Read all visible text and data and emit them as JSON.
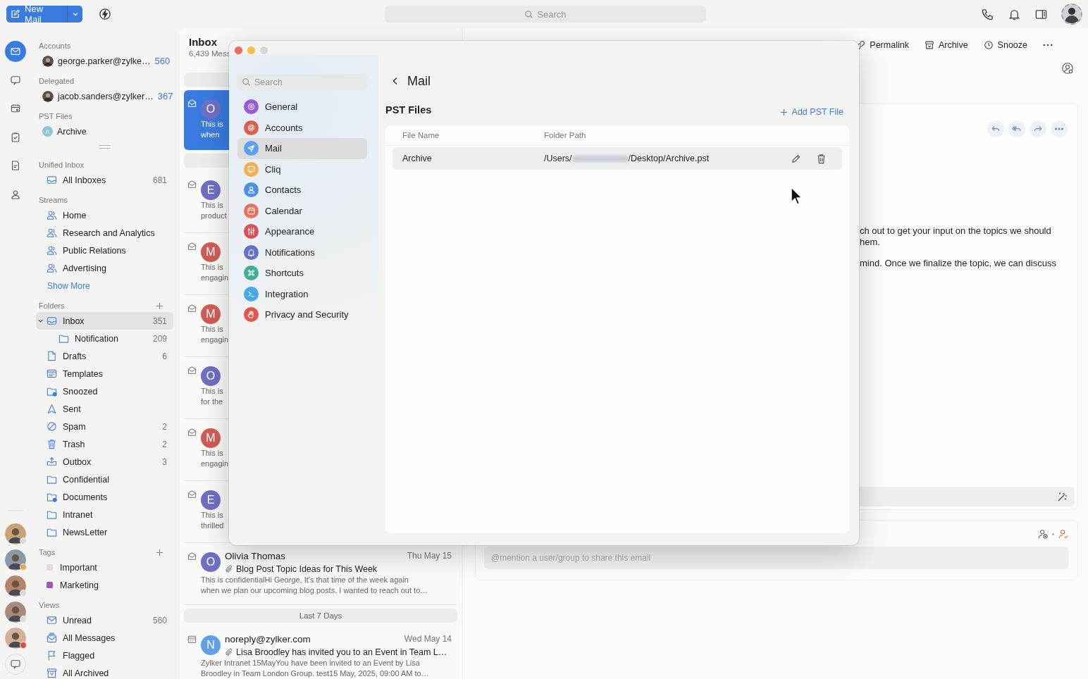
{
  "toolbar": {
    "new_mail": "New Mail",
    "search": {
      "placeholder": "Search"
    }
  },
  "rail": {
    "apps": [
      {
        "kind": "mail",
        "selected": true
      },
      {
        "kind": "chat",
        "selected": false
      },
      {
        "kind": "calendar",
        "selected": false
      },
      {
        "kind": "tasks",
        "selected": false
      },
      {
        "kind": "notes",
        "selected": false
      },
      {
        "kind": "contacts",
        "selected": false
      }
    ],
    "people": [
      {
        "color": "#d9d9d9"
      },
      {
        "color": "#f0a04b"
      },
      {
        "color": "#d9d9d9"
      },
      {
        "color": "#d9d9d9"
      },
      {
        "color": "#e8453c"
      }
    ]
  },
  "sidebar": {
    "sections": [
      {
        "title": "Accounts",
        "add": false,
        "items": [
          {
            "kind": "account",
            "label": "george.parker@zylke…",
            "count": "560",
            "selected": false
          }
        ]
      },
      {
        "title": "Delegated",
        "add": false,
        "items": [
          {
            "kind": "account",
            "label": "jacob.sanders@zylker…",
            "count": "367",
            "selected": false
          }
        ]
      },
      {
        "title": "PST Files",
        "add": false,
        "handle": true,
        "items": [
          {
            "kind": "pst",
            "badge": "A",
            "label": "Archive",
            "selected": false
          }
        ]
      },
      {
        "title": "Unified Inbox",
        "add": false,
        "items": [
          {
            "kind": "all-inboxes",
            "label": "All Inboxes",
            "count": "681",
            "selected": false
          }
        ]
      },
      {
        "title": "Streams",
        "add": false,
        "more": "Show More",
        "items": [
          {
            "kind": "stream",
            "label": "Home",
            "selected": false
          },
          {
            "kind": "stream",
            "label": "Research and Analytics",
            "selected": false
          },
          {
            "kind": "stream",
            "label": "Public Relations",
            "selected": false
          },
          {
            "kind": "stream",
            "label": "Advertising",
            "selected": false
          }
        ]
      },
      {
        "title": "Folders",
        "add": true,
        "items": [
          {
            "kind": "inbox",
            "label": "Inbox",
            "count": "351",
            "selected": true,
            "expanded": true,
            "children": [
              {
                "kind": "folder",
                "label": "Notification",
                "count": "209",
                "selected": false
              }
            ]
          },
          {
            "kind": "drafts",
            "label": "Drafts",
            "count": "6",
            "selected": false
          },
          {
            "kind": "templates",
            "label": "Templates",
            "selected": false
          },
          {
            "kind": "snoozed",
            "label": "Snoozed",
            "selected": false
          },
          {
            "kind": "sent",
            "label": "Sent",
            "selected": false
          },
          {
            "kind": "spam",
            "label": "Spam",
            "count": "2",
            "selected": false
          },
          {
            "kind": "trash",
            "label": "Trash",
            "count": "2",
            "selected": false
          },
          {
            "kind": "outbox",
            "label": "Outbox",
            "count": "3",
            "selected": false
          },
          {
            "kind": "folder",
            "label": "Confidential",
            "selected": false
          },
          {
            "kind": "shared-folder",
            "label": "Documents",
            "selected": false
          },
          {
            "kind": "folder",
            "label": "Intranet",
            "selected": false
          },
          {
            "kind": "folder",
            "label": "NewsLetter",
            "selected": false
          }
        ]
      },
      {
        "title": "Tags",
        "add": true,
        "items": [
          {
            "kind": "tag",
            "label": "Important",
            "color": "#ead6d6",
            "selected": false
          },
          {
            "kind": "tag",
            "label": "Marketing",
            "color": "#9b59b6",
            "selected": false
          }
        ]
      },
      {
        "title": "Views",
        "add": false,
        "items": [
          {
            "kind": "unread",
            "label": "Unread",
            "count": "560",
            "selected": false
          },
          {
            "kind": "all-messages",
            "label": "All Messages",
            "selected": false
          },
          {
            "kind": "flagged",
            "label": "Flagged",
            "selected": false
          },
          {
            "kind": "archived",
            "label": "All Archived",
            "selected": false
          }
        ]
      }
    ]
  },
  "mail_list": {
    "title": "Inbox",
    "subtitle": "6,439 Mess",
    "rows": [
      {
        "kind": "group"
      },
      {
        "kind": "mail",
        "avatar": "O",
        "color": "#6f6fc4",
        "preview_lines": [
          "This is",
          "when"
        ],
        "selected": true
      },
      {
        "kind": "group"
      },
      {
        "kind": "mail",
        "avatar": "E",
        "color": "#6f6fc4",
        "preview_lines": [
          "This is",
          "product"
        ],
        "selected": false
      },
      {
        "kind": "mail",
        "avatar": "M",
        "color": "#cf5e57",
        "preview_lines": [
          "This is",
          "engagin"
        ],
        "selected": false
      },
      {
        "kind": "mail",
        "avatar": "M",
        "color": "#cf5e57",
        "preview_lines": [
          "This is",
          "engagin"
        ],
        "selected": false
      },
      {
        "kind": "mail",
        "avatar": "O",
        "color": "#6f6fc4",
        "preview_lines": [
          "This is",
          "for the"
        ],
        "selected": false
      },
      {
        "kind": "mail",
        "avatar": "M",
        "color": "#cf5e57",
        "preview_lines": [
          "This is",
          "engagin"
        ],
        "selected": false
      },
      {
        "kind": "mail",
        "avatar": "E",
        "color": "#6f6fc4",
        "preview_lines": [
          "This is",
          "thrilled"
        ],
        "selected": false
      },
      {
        "kind": "mail",
        "avatar": "O",
        "color": "#6f6fc4",
        "sender": "Olivia Thomas",
        "date": "Thu May 15",
        "attachment": true,
        "subject": "Blog Post Topic Ideas for This Week",
        "preview_lines": [
          "This is confidentialHi George, It's that time of the week again",
          "when we plan our upcoming blog posts. I wanted to reach out to…"
        ],
        "selected": false
      },
      {
        "kind": "group",
        "label": "Last 7 Days"
      },
      {
        "kind": "event",
        "avatar": "N",
        "color": "#5fa0e8",
        "sender": "noreply@zylker.com",
        "date": "Wed May 14",
        "attachment": true,
        "subject": "Lisa Broodley has invited you to an Event in Team L…",
        "preview_lines": [
          "Zylker Intranet 15MayYou have been invited to an Event by Lisa",
          "Broodley in Team London Group. test15 May, 2025, 09:00 AM to…"
        ],
        "selected": false
      }
    ]
  },
  "detail": {
    "actions": [
      {
        "kind": "permalink",
        "label": "Permalink"
      },
      {
        "kind": "archive",
        "label": "Archive"
      },
      {
        "kind": "snooze",
        "label": "Snooze"
      }
    ],
    "body_lines": [
      "ch out to get your input on the topics we should",
      "hem.",
      "mind. Once we finalize the topic, we can discuss"
    ],
    "mention": {
      "placeholder": "@mention a user/group to share this email"
    }
  },
  "settings": {
    "search": {
      "placeholder": "Search"
    },
    "categories": [
      {
        "kind": "general",
        "label": "General",
        "color": "#9a5bd6",
        "selected": false
      },
      {
        "kind": "accounts",
        "label": "Accounts",
        "color": "#d9604f",
        "selected": false
      },
      {
        "kind": "mail",
        "label": "Mail",
        "color": "#5a9ff0",
        "selected": true
      },
      {
        "kind": "cliq",
        "label": "Cliq",
        "color": "#f2b04e",
        "selected": false
      },
      {
        "kind": "contacts",
        "label": "Contacts",
        "color": "#4e8fe6",
        "selected": false
      },
      {
        "kind": "calendar",
        "label": "Calendar",
        "color": "#ea7059",
        "selected": false
      },
      {
        "kind": "appearance",
        "label": "Appearance",
        "color": "#d9505a",
        "selected": false
      },
      {
        "kind": "notifications",
        "label": "Notifications",
        "color": "#6470c8",
        "selected": false
      },
      {
        "kind": "shortcuts",
        "label": "Shortcuts",
        "color": "#3eae98",
        "selected": false
      },
      {
        "kind": "integration",
        "label": "Integration",
        "color": "#4aa8e8",
        "selected": false
      },
      {
        "kind": "privacy",
        "label": "Privacy and Security",
        "color": "#e0574d",
        "selected": false
      }
    ],
    "page": {
      "title": "Mail",
      "section": "PST Files",
      "add": "Add PST File",
      "columns": [
        "File Name",
        "Folder Path"
      ],
      "files": [
        {
          "name": "Archive",
          "path_start": "/Users/",
          "redacted": true,
          "path_end": "/Desktop/Archive.pst"
        }
      ]
    }
  }
}
